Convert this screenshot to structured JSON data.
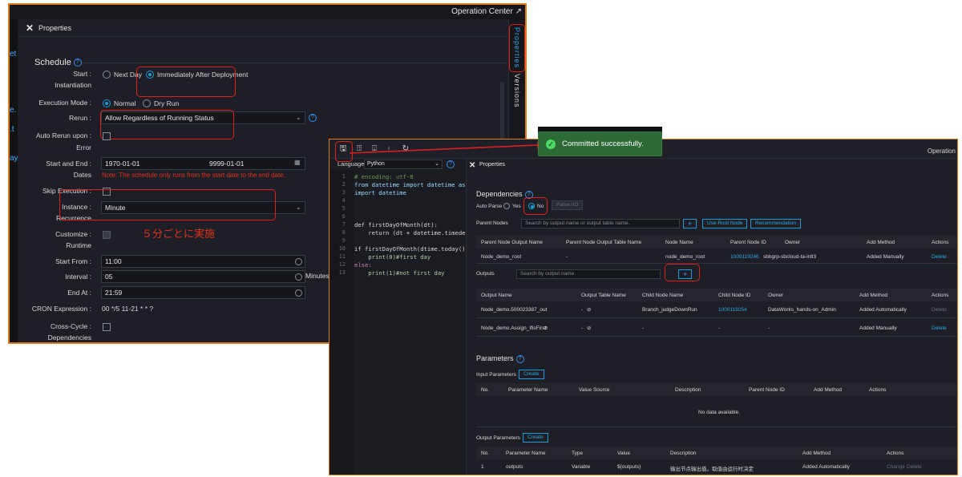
{
  "left_window": {
    "top_title": "Operation Center",
    "panel_title": "Properties",
    "side_tabs": [
      "Properties",
      "Versions"
    ],
    "left_strip_fragments": [
      "et",
      "e.",
      ".t",
      "ay"
    ],
    "schedule_title": "Schedule",
    "start_instantiation": {
      "label": "Start :",
      "label2": "Instantiation",
      "options": [
        "Next Day",
        "Immediately After Deployment"
      ],
      "selected": "Immediately After Deployment"
    },
    "execution_mode": {
      "label": "Execution Mode :",
      "options": [
        "Normal",
        "Dry Run"
      ],
      "selected": "Normal"
    },
    "rerun": {
      "label": "Rerun :",
      "value": "Allow Regardless of Running Status"
    },
    "auto_rerun": {
      "label": "Auto Rerun upon :",
      "label2": "Error"
    },
    "start_end_dates": {
      "label": "Start and End :",
      "label2": "Dates",
      "start": "1970-01-01",
      "end": "9999-01-01",
      "note": "Note: The schedule only runs from the start date to the end date."
    },
    "skip_execution": {
      "label": "Skip Execution :"
    },
    "instance_recurrence": {
      "label": "Instance :",
      "label2": "Recurrence",
      "value": "Minute"
    },
    "annotation_jp": "５分ごとに実施",
    "customize_runtime": {
      "label": "Customize :",
      "label2": "Runtime"
    },
    "start_from": {
      "label": "Start From :",
      "value": "11:00"
    },
    "interval": {
      "label": "Interval :",
      "value": "05",
      "unit": "Minutes"
    },
    "end_at": {
      "label": "End At :",
      "value": "21:59"
    },
    "cron": {
      "label": "CRON Expression :",
      "value": "00 */5 11-21 * * ?"
    },
    "cross_cycle": {
      "label": "Cross-Cycle :",
      "label2": "Dependencies"
    }
  },
  "toast": {
    "message": "Committed successfully."
  },
  "right_window": {
    "top_right": "Operation",
    "language_label": "Language:",
    "language_value": "Python",
    "code_lines": [
      "# encoding: utf-8",
      "from datetime import datetime as dt",
      "import datetime",
      "",
      "",
      "",
      "def firstDayOfMonth(dt):",
      "    return (dt + datetime.timedelta",
      "",
      "if firstDayOfMonth(dtime.today()).",
      "    print(0)#first day",
      "else:",
      "    print(1)#not first day"
    ],
    "line_numbers": [
      "1",
      "2",
      "3",
      "4",
      "5",
      "6",
      "7",
      "8",
      "9",
      "10",
      "11",
      "12",
      "13"
    ],
    "panel_title": "Properties",
    "dependencies": {
      "title": "Dependencies",
      "auto_parse_label": "Auto Parse",
      "auto_parse_options": [
        "Yes",
        "No"
      ],
      "auto_parse_selected": "No",
      "parse_io": "Parse I/O",
      "parent_nodes_label": "Parent Nodes",
      "parent_search_placeholder": "Search by output name or output table name.",
      "use_root_node": "Use Root Node",
      "recommendation": "Recommendation",
      "parent_headers": [
        "Parent Node Output Name",
        "Parent Node Output Table Name",
        "Node Name",
        "Parent Node ID",
        "Owner",
        "Add Method",
        "Actions"
      ],
      "parent_rows": [
        [
          "Node_demo_root",
          "-",
          "node_demo_root",
          "1000119246",
          "sbbgrp-sbcloud-ta-intl3",
          "Added Manually",
          "Delete"
        ]
      ],
      "outputs_label": "Outputs",
      "outputs_search_placeholder": "Search by output name.",
      "output_headers": [
        "Output Name",
        "Output Table Name",
        "Child Node Name",
        "Child Node ID",
        "Owner",
        "Add Method",
        "Actions"
      ],
      "output_rows": [
        [
          "Node_demo.500023387_out",
          "-",
          "Branch_judgeDownRun",
          "1000119254",
          "DataWorks_hands-on_Admin",
          "Added Automatically",
          "Delete"
        ],
        [
          "Node_demo.Assign_IfisFirst",
          "-",
          "-",
          "-",
          "-",
          "Added Manually",
          "Delete"
        ]
      ]
    },
    "parameters": {
      "title": "Parameters",
      "input_label": "Input Parameters",
      "create": "Create",
      "input_headers": [
        "No.",
        "Parameter Name",
        "Value Source",
        "Description",
        "Parent Node ID",
        "Add Method",
        "Actions"
      ],
      "no_data": "No data available.",
      "output_label": "Output Parameters",
      "output_headers": [
        "No.",
        "Parameter Name",
        "Type",
        "Value",
        "Description",
        "Add Method",
        "Actions"
      ],
      "output_rows": [
        [
          "1",
          "outputs",
          "Variable",
          "${outputs}",
          "输出节点输出值，取值由运行时决定",
          "Added Automatically",
          "Change",
          "Delete"
        ]
      ]
    }
  },
  "colors": {
    "accent": "#1a9bd7",
    "highlight_red": "#e0201f",
    "window_border": "#e07a1f",
    "toast_bg": "#2d6a36"
  }
}
